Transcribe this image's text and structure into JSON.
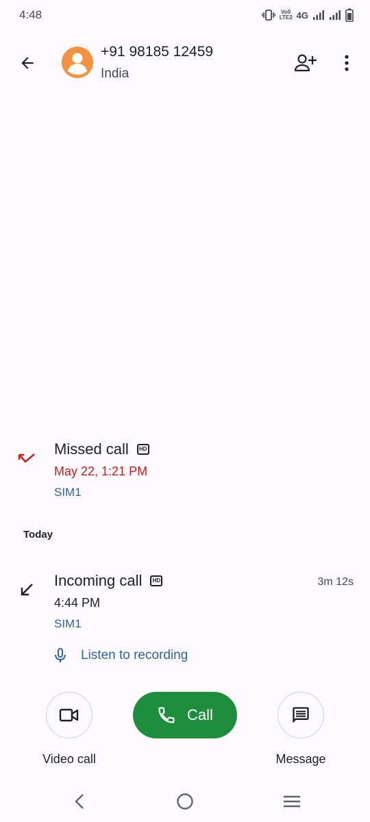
{
  "status_bar": {
    "time": "4:48",
    "volte_top": "Vo0",
    "volte_bottom": "LTE2",
    "network": "4G"
  },
  "header": {
    "contact_number": "+91 98185 12459",
    "contact_country": "India"
  },
  "calls": [
    {
      "type": "Missed call",
      "time": "May 22, 1:21 PM",
      "sim": "SIM1",
      "hd": "HD",
      "time_color": "#C5221F",
      "icon": "missed-call-icon"
    },
    {
      "type": "Incoming call",
      "time": "4:44 PM",
      "sim": "SIM1",
      "hd": "HD",
      "duration": "3m 12s",
      "icon": "incoming-call-icon"
    }
  ],
  "section_today": "Today",
  "recording": {
    "label": "Listen to recording"
  },
  "actions": {
    "video_call_label": "Video call",
    "call_label": "Call",
    "message_label": "Message"
  },
  "colors": {
    "background": "#FCFAFE",
    "accent_green": "#1E8E3E",
    "avatar": "#F4923F",
    "missed_red": "#C5221F",
    "link_blue": "#2F64A0"
  }
}
